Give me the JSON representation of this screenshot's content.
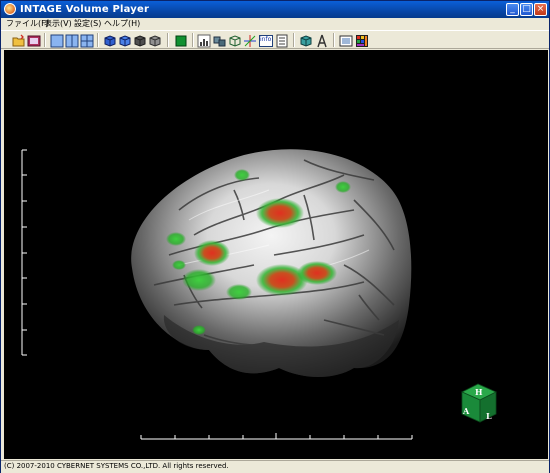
{
  "window": {
    "title": "INTAGE Volume Player",
    "minimize_label": "_",
    "maximize_label": "□",
    "close_label": "×"
  },
  "menu": {
    "items": [
      {
        "label": "ファイル(F)"
      },
      {
        "label": "表示(V)"
      },
      {
        "label": "設定(S)"
      },
      {
        "label": "ヘルプ(H)"
      }
    ]
  },
  "toolbar": {
    "info_label": "info"
  },
  "orientation_cube": {
    "top_label": "H",
    "front_label": "A",
    "side_label": "L"
  },
  "status": {
    "text": "(C) 2007-2010 CYBERNET SYSTEMS CO.,LTD. All rights reserved."
  },
  "colors": {
    "titlebar": "#0a5fd8",
    "viewport_bg": "#000000",
    "activation_red": "#e03020",
    "activation_green": "#30c030",
    "cube_green": "#1a8a3a"
  }
}
